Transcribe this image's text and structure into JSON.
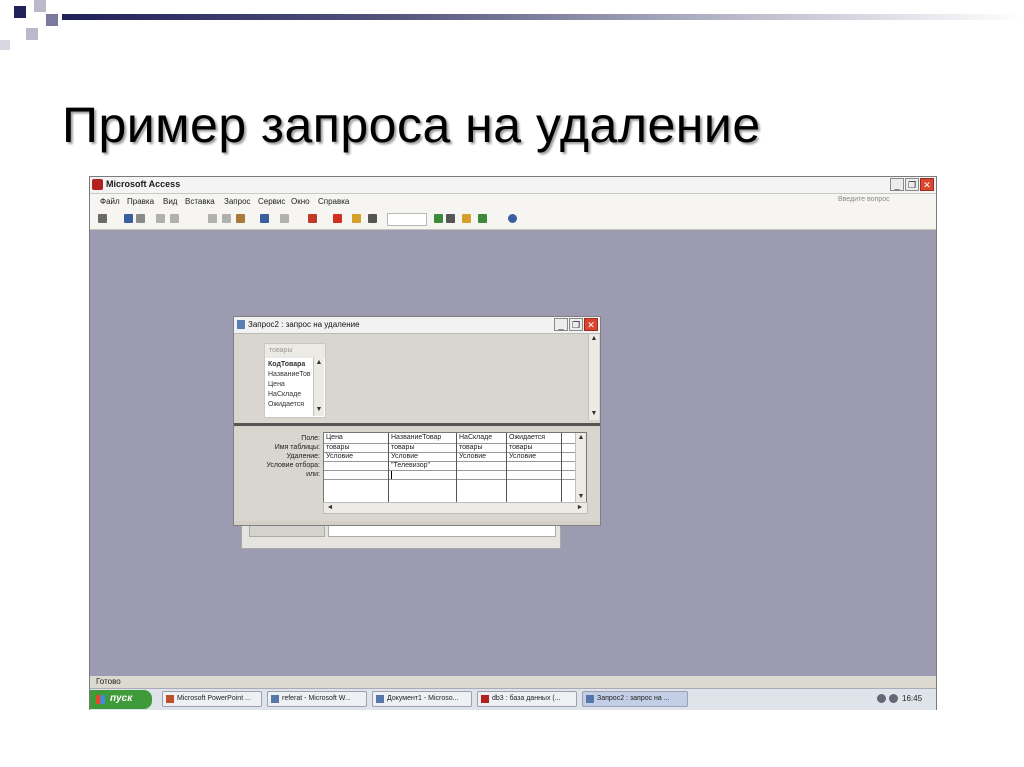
{
  "slide": {
    "title": "Пример запроса на удаление"
  },
  "access": {
    "title": "Microsoft Access",
    "menu": [
      "Файл",
      "Правка",
      "Вид",
      "Вставка",
      "Запрос",
      "Сервис",
      "Окно",
      "Справка"
    ],
    "help_placeholder": "Введите вопрос",
    "window_buttons": {
      "minimize": "_",
      "restore": "❐",
      "close": "✕"
    },
    "status_text": "Готово"
  },
  "query_window": {
    "title": "Запрос2 : запрос на удаление",
    "table": {
      "name": "товары",
      "fields": [
        "КодТовара",
        "НазваниеТов",
        "Цена",
        "НаСкладе",
        "Ожидается"
      ]
    },
    "row_labels": [
      "Поле:",
      "Имя таблицы:",
      "Удаление:",
      "Условие отбора:",
      "или:"
    ],
    "columns": [
      {
        "field": "Цена",
        "table": "товары",
        "delete": "Условие",
        "criteria": ""
      },
      {
        "field": "НазваниеТовар",
        "table": "товары",
        "delete": "Условие",
        "criteria": "\"Телевизор\""
      },
      {
        "field": "НаСкладе",
        "table": "товары",
        "delete": "Условие",
        "criteria": ""
      },
      {
        "field": "Ожидается",
        "table": "товары",
        "delete": "Условие",
        "criteria": ""
      }
    ]
  },
  "taskbar": {
    "start_label": "пуск",
    "tasks": [
      "Microsoft PowerPoint ...",
      "referat - Microsoft W...",
      "Документ1 - Microso...",
      "db3 : база данных (...",
      "Запрос2 : запрос на ..."
    ],
    "clock": "16:45"
  },
  "colors": {
    "workspace": "#9c9bb2",
    "title_accent": "#20205a",
    "start_button": "#3f9a3a"
  }
}
